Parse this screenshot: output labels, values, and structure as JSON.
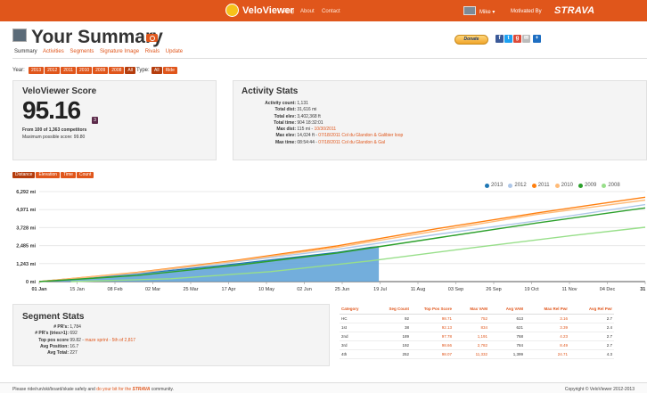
{
  "header": {
    "app_name": "VeloViewer",
    "nav": [
      "Blog",
      "About",
      "Contact"
    ],
    "user_name": "Mike",
    "user_caret": "▾",
    "motivated_by": "Motivated By",
    "strava_logo": "STRAVA",
    "brand_color": "#e0561b"
  },
  "page": {
    "title": "Your Summary",
    "donate_label": "Donate",
    "share_icons": [
      "facebook-icon",
      "twitter-icon",
      "google-plus-icon",
      "email-icon",
      "plus-icon"
    ]
  },
  "subnav": [
    "Summary",
    "Activities",
    "Segments",
    "Signature Image",
    "Rivals",
    "Update"
  ],
  "filters": {
    "year_label": "Year:",
    "years": [
      "2013",
      "2012",
      "2011",
      "2010",
      "2009",
      "2008",
      "All"
    ],
    "year_selected": "All",
    "type_label": "Type:",
    "types": [
      "All",
      "Ride"
    ],
    "type_selected": "All"
  },
  "score": {
    "title": "VeloViewer Score",
    "value": "95.16",
    "rank_badge": "3",
    "from_text": "From 100 of 1,363 competitors",
    "max_text": "Maximum possible score: 99.80"
  },
  "activity_stats": {
    "title": "Activity Stats",
    "rows": [
      {
        "label": "Activity count:",
        "value": "1,131",
        "link": ""
      },
      {
        "label": "Total dist:",
        "value": "31,616 mi",
        "link": ""
      },
      {
        "label": "Total elev:",
        "value": "3,402,368 ft",
        "link": ""
      },
      {
        "label": "Total time:",
        "value": "904 18:32:01",
        "link": ""
      },
      {
        "label": "Max dist:",
        "value": "115 mi - ",
        "link": "10/30/2011"
      },
      {
        "label": "Max elev:",
        "value": "14,024 ft - ",
        "link": "07/18/2011 Col du Glandon & Galibier loop"
      },
      {
        "label": "Max time:",
        "value": "08:54:44 - ",
        "link": "07/18/2011 Col du Glandon & Gal"
      }
    ]
  },
  "chart_tabs": [
    "Distance",
    "Elevation",
    "Time",
    "Count"
  ],
  "chart_tab_selected": "Distance",
  "chart_data": {
    "type": "line",
    "title": "",
    "xlabel": "",
    "ylabel": "",
    "x_ticks": [
      "01 Jan",
      "15 Jan",
      "08 Feb",
      "02 Mar",
      "25 Mar",
      "17 Apr",
      "10 May",
      "02 Jun",
      "25 Jun",
      "19 Jul",
      "11 Aug",
      "03 Sep",
      "26 Sep",
      "19 Oct",
      "11 Nov",
      "04 Dec",
      "31 D"
    ],
    "y_ticks": [
      "0 mi",
      "1,243 mi",
      "2,485 mi",
      "3,728 mi",
      "4,971 mi",
      "6,292 mi"
    ],
    "ylim": [
      0,
      6292
    ],
    "x_unit": "day of year",
    "xlim": [
      1,
      365
    ],
    "grid": true,
    "legend_position": "top-right",
    "series": [
      {
        "name": "2013",
        "color": "#1f77b4",
        "style": "area",
        "points": [
          [
            1,
            0
          ],
          [
            30,
            240
          ],
          [
            60,
            560
          ],
          [
            90,
            900
          ],
          [
            120,
            1250
          ],
          [
            150,
            1650
          ],
          [
            180,
            2050
          ],
          [
            200,
            2400
          ],
          [
            205,
            2450
          ]
        ]
      },
      {
        "name": "2012",
        "color": "#aec7e8",
        "points": [
          [
            1,
            0
          ],
          [
            60,
            600
          ],
          [
            120,
            1400
          ],
          [
            180,
            2250
          ],
          [
            240,
            3300
          ],
          [
            300,
            4250
          ],
          [
            365,
            5380
          ]
        ]
      },
      {
        "name": "2011",
        "color": "#ff7f0e",
        "points": [
          [
            1,
            0
          ],
          [
            60,
            650
          ],
          [
            120,
            1500
          ],
          [
            180,
            2500
          ],
          [
            240,
            3700
          ],
          [
            300,
            4800
          ],
          [
            365,
            5900
          ]
        ]
      },
      {
        "name": "2010",
        "color": "#ffbb78",
        "points": [
          [
            1,
            0
          ],
          [
            60,
            630
          ],
          [
            120,
            1450
          ],
          [
            180,
            2400
          ],
          [
            240,
            3550
          ],
          [
            300,
            4700
          ],
          [
            365,
            5700
          ]
        ]
      },
      {
        "name": "2009",
        "color": "#2ca02c",
        "points": [
          [
            1,
            0
          ],
          [
            60,
            430
          ],
          [
            120,
            1150
          ],
          [
            180,
            2000
          ],
          [
            240,
            3050
          ],
          [
            300,
            4100
          ],
          [
            365,
            5150
          ]
        ]
      },
      {
        "name": "2008",
        "color": "#98df8a",
        "points": [
          [
            20,
            0
          ],
          [
            80,
            200
          ],
          [
            140,
            700
          ],
          [
            200,
            1450
          ],
          [
            260,
            2350
          ],
          [
            320,
            3200
          ],
          [
            365,
            3800
          ]
        ]
      }
    ]
  },
  "segment_stats": {
    "title": "Segment Stats",
    "rows": [
      {
        "label": "# PR's:",
        "value": "1,784",
        "link": ""
      },
      {
        "label": "# PR's (tries>1):",
        "value": "692",
        "link": ""
      },
      {
        "label": "Top pos score",
        "value": "99.82 - ",
        "link": "maze sprint - 5th of 2,817"
      },
      {
        "label": "Avg Position:",
        "value": "16.7",
        "link": ""
      },
      {
        "label": "Avg Total:",
        "value": "227",
        "link": ""
      }
    ]
  },
  "category_table": {
    "headers": [
      "Category",
      "Seg Count",
      "Top Pos Score",
      "Max VAM",
      "Avg VAM",
      "Max Rel Pwr",
      "Avg Rel Pwr"
    ],
    "rows": [
      [
        "HC",
        "92",
        "98.71",
        "752",
        "613",
        "3.16",
        "2.7"
      ],
      [
        "1st",
        "38",
        "92.13",
        "834",
        "621",
        "3.39",
        "2.4"
      ],
      [
        "2nd",
        "189",
        "97.78",
        "1,191",
        "768",
        "4.23",
        "2.7"
      ],
      [
        "3rd",
        "192",
        "98.66",
        "2,782",
        "784",
        "8.49",
        "2.7"
      ],
      [
        "4th",
        "252",
        "98.07",
        "11,332",
        "1,399",
        "24.71",
        "4.3"
      ]
    ]
  },
  "footer": {
    "left_text": "Please ride/run/ski/board/skate safely and ",
    "left_link": "do your bit for the",
    "strava": "STRAVA",
    "left_end": " community.",
    "right_text": "Copyright © VeloViewer 2012-2013"
  }
}
